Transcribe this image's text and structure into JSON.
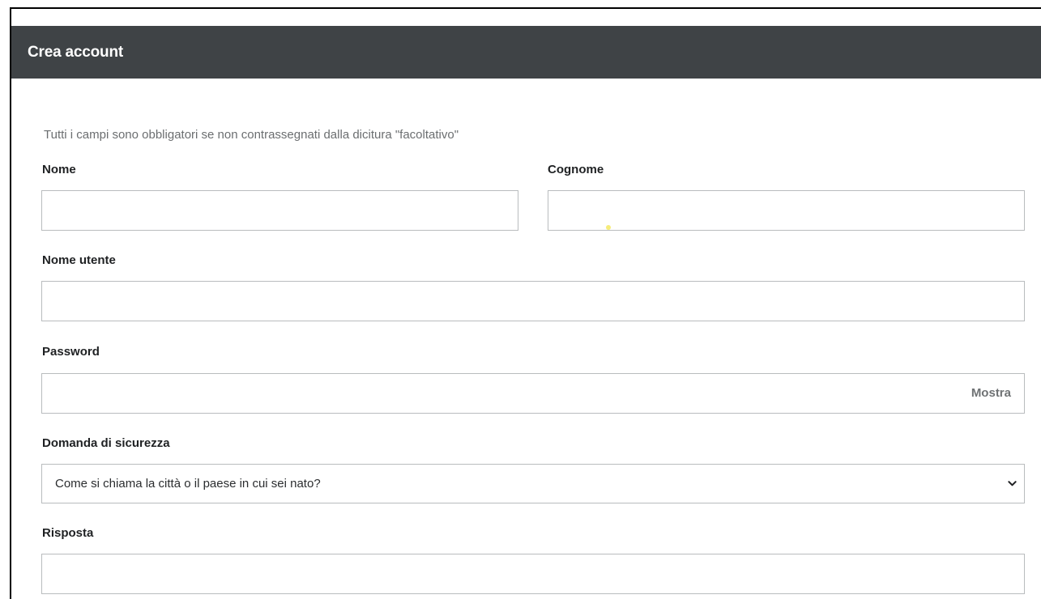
{
  "header": {
    "title": "Crea account"
  },
  "form": {
    "required_note": "Tutti i campi sono obbligatori se non contrassegnati dalla dicitura \"facoltativo\"",
    "first_name": {
      "label": "Nome",
      "value": ""
    },
    "last_name": {
      "label": "Cognome",
      "value": ""
    },
    "username": {
      "label": "Nome utente",
      "value": ""
    },
    "password": {
      "label": "Password",
      "value": "",
      "show_label": "Mostra"
    },
    "security_question": {
      "label": "Domanda di sicurezza",
      "selected": "Come si chiama la città o il paese in cui sei nato?",
      "icon": "chevron-down-icon"
    },
    "answer": {
      "label": "Risposta",
      "value": ""
    }
  },
  "colors": {
    "header_bg": "#3f4346",
    "input_border": "#b9bcbe",
    "muted_text": "#6b6e70"
  }
}
